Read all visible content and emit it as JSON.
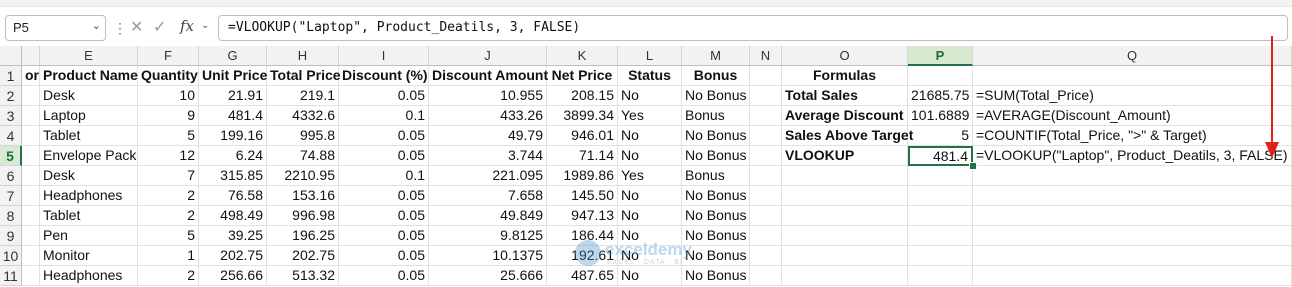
{
  "formula_bar": {
    "name_box": "P5",
    "formula": "=VLOOKUP(\"Laptop\", Product_Deatils, 3, FALSE)"
  },
  "columns": [
    "",
    "E",
    "F",
    "G",
    "H",
    "I",
    "J",
    "K",
    "L",
    "M",
    "N",
    "O",
    "P",
    "Q"
  ],
  "rows": [
    "1",
    "2",
    "3",
    "4",
    "5",
    "6",
    "7",
    "8",
    "9",
    "10",
    "11"
  ],
  "header_row": {
    "D": "ory",
    "E": "Product Name",
    "F": "Quantity",
    "G": "Unit Price",
    "H": "Total Price",
    "I": "Discount (%)",
    "J": "Discount Amount",
    "K": "Net Price",
    "L": "Status",
    "M": "Bonus"
  },
  "table": [
    {
      "E": "Desk",
      "F": "10",
      "G": "21.91",
      "H": "219.1",
      "I": "0.05",
      "J": "10.955",
      "K": "208.15",
      "L": "No",
      "M": "No Bonus"
    },
    {
      "E": "Laptop",
      "F": "9",
      "G": "481.4",
      "H": "4332.6",
      "I": "0.1",
      "J": "433.26",
      "K": "3899.34",
      "L": "Yes",
      "M": "Bonus"
    },
    {
      "E": "Tablet",
      "F": "5",
      "G": "199.16",
      "H": "995.8",
      "I": "0.05",
      "J": "49.79",
      "K": "946.01",
      "L": "No",
      "M": "No Bonus"
    },
    {
      "E": "Envelope Pack",
      "F": "12",
      "G": "6.24",
      "H": "74.88",
      "I": "0.05",
      "J": "3.744",
      "K": "71.14",
      "L": "No",
      "M": "No Bonus"
    },
    {
      "E": "Desk",
      "F": "7",
      "G": "315.85",
      "H": "2210.95",
      "I": "0.1",
      "J": "221.095",
      "K": "1989.86",
      "L": "Yes",
      "M": "Bonus"
    },
    {
      "E": "Headphones",
      "F": "2",
      "G": "76.58",
      "H": "153.16",
      "I": "0.05",
      "J": "7.658",
      "K": "145.50",
      "L": "No",
      "M": "No Bonus"
    },
    {
      "E": "Tablet",
      "F": "2",
      "G": "498.49",
      "H": "996.98",
      "I": "0.05",
      "J": "49.849",
      "K": "947.13",
      "L": "No",
      "M": "No Bonus"
    },
    {
      "E": "Pen",
      "F": "5",
      "G": "39.25",
      "H": "196.25",
      "I": "0.05",
      "J": "9.8125",
      "K": "186.44",
      "L": "No",
      "M": "No Bonus"
    },
    {
      "E": "Monitor",
      "F": "1",
      "G": "202.75",
      "H": "202.75",
      "I": "0.05",
      "J": "10.1375",
      "K": "192.61",
      "L": "No",
      "M": "No Bonus"
    },
    {
      "E": "Headphones",
      "F": "2",
      "G": "256.66",
      "H": "513.32",
      "I": "0.05",
      "J": "25.666",
      "K": "487.65",
      "L": "No",
      "M": "No Bonus"
    }
  ],
  "formulas_panel": {
    "heading": "Formulas",
    "items": [
      {
        "label": "Total Sales",
        "value": "21685.75",
        "formula": "=SUM(Total_Price)"
      },
      {
        "label": "Average Discount",
        "value": "101.6889",
        "formula": "=AVERAGE(Discount_Amount)"
      },
      {
        "label": "Sales Above Target",
        "value": "5",
        "formula": "=COUNTIF(Total_Price, \">\" & Target)"
      },
      {
        "label": "VLOOKUP",
        "value": "481.4",
        "formula": "=VLOOKUP(\"Laptop\", Product_Deatils, 3, FALSE)"
      }
    ]
  },
  "watermark": {
    "name": "exceldemy",
    "tagline": "EXCEL · DATA · BI"
  },
  "colors": {
    "selection": "#217346",
    "arrow": "#e0201b",
    "header_bg": "#f2f2f2"
  },
  "icons": [
    "chevron-down-icon",
    "more-options-icon",
    "cancel-icon",
    "enter-icon",
    "insert-function-icon"
  ]
}
